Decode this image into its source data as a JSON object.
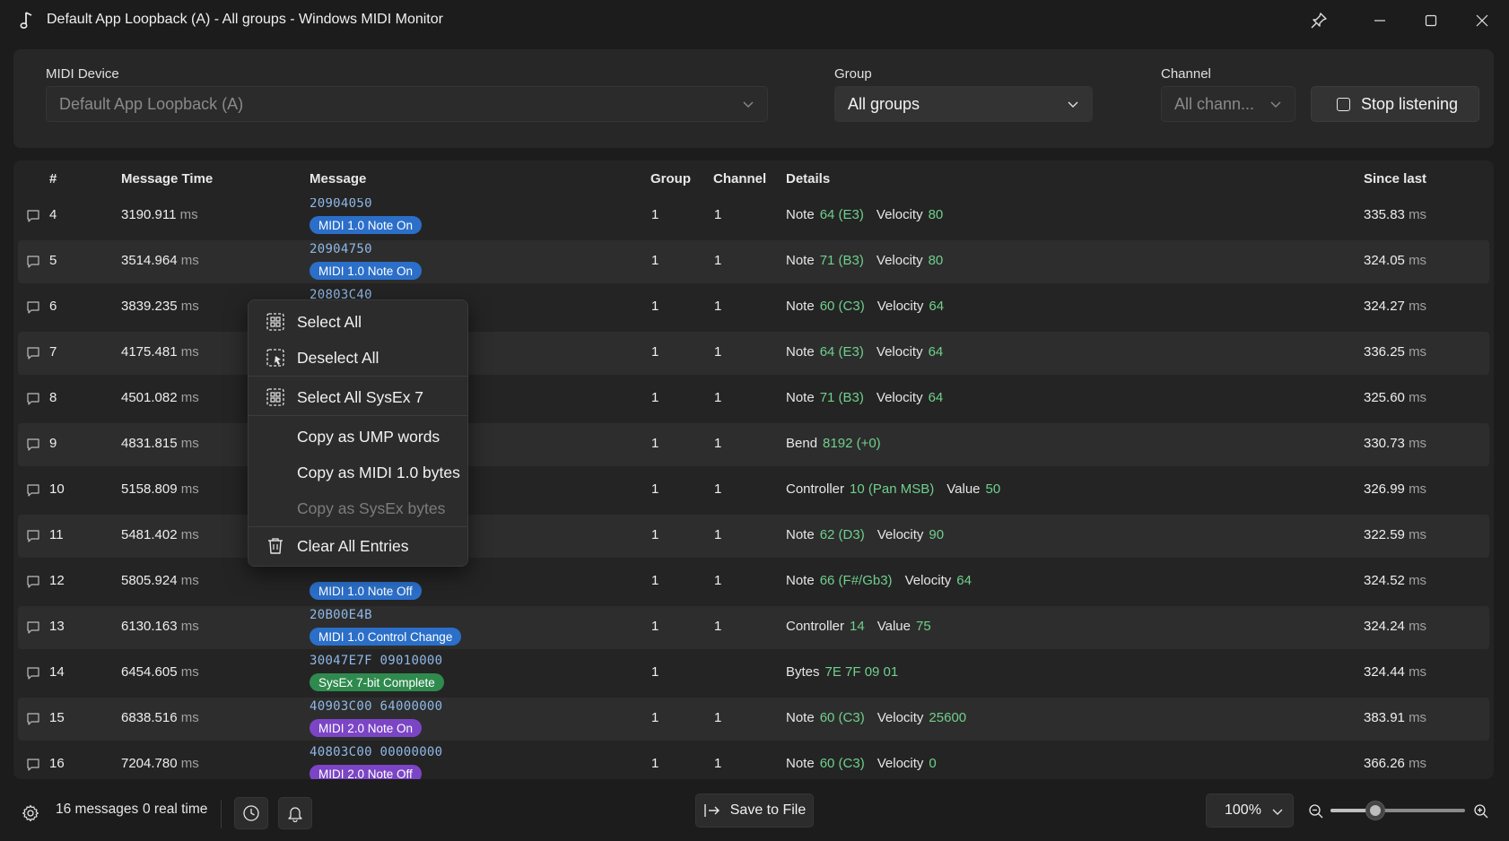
{
  "window": {
    "title": "Default App Loopback (A) - All groups - Windows MIDI Monitor"
  },
  "filters": {
    "midi_device_label": "MIDI Device",
    "midi_device_value": "Default App Loopback (A)",
    "group_label": "Group",
    "group_value": "All groups",
    "channel_label": "Channel",
    "channel_value": "All chann...",
    "stop_listening_label": "Stop listening"
  },
  "table": {
    "headers": {
      "num": "#",
      "time": "Message Time",
      "message": "Message",
      "group": "Group",
      "channel": "Channel",
      "details": "Details",
      "since_last": "Since last"
    },
    "unit": "ms",
    "rows": [
      {
        "num": "4",
        "time": "3190.911",
        "hex": "20904050",
        "badge": "MIDI 1.0 Note On",
        "kind": "m1",
        "group": "1",
        "channel": "1",
        "details": [
          [
            "Note",
            "64 (E3)"
          ],
          [
            "Velocity",
            "80"
          ]
        ],
        "since": "335.83"
      },
      {
        "num": "5",
        "time": "3514.964",
        "hex": "20904750",
        "badge": "MIDI 1.0 Note On",
        "kind": "m1",
        "group": "1",
        "channel": "1",
        "details": [
          [
            "Note",
            "71 (B3)"
          ],
          [
            "Velocity",
            "80"
          ]
        ],
        "since": "324.05"
      },
      {
        "num": "6",
        "time": "3839.235",
        "hex": "20803C40",
        "badge": "",
        "kind": "m1",
        "group": "1",
        "channel": "1",
        "details": [
          [
            "Note",
            "60 (C3)"
          ],
          [
            "Velocity",
            "64"
          ]
        ],
        "since": "324.27"
      },
      {
        "num": "7",
        "time": "4175.481",
        "hex": "",
        "badge": "",
        "kind": "m1",
        "group": "1",
        "channel": "1",
        "details": [
          [
            "Note",
            "64 (E3)"
          ],
          [
            "Velocity",
            "64"
          ]
        ],
        "since": "336.25"
      },
      {
        "num": "8",
        "time": "4501.082",
        "hex": "",
        "badge": "",
        "kind": "m1",
        "group": "1",
        "channel": "1",
        "details": [
          [
            "Note",
            "71 (B3)"
          ],
          [
            "Velocity",
            "64"
          ]
        ],
        "since": "325.60"
      },
      {
        "num": "9",
        "time": "4831.815",
        "hex": "",
        "badge": "",
        "kind": "m1",
        "group": "1",
        "channel": "1",
        "details": [
          [
            "Bend",
            "8192 (+0)"
          ]
        ],
        "since": "330.73"
      },
      {
        "num": "10",
        "time": "5158.809",
        "hex": "",
        "badge": "",
        "kind": "m1",
        "group": "1",
        "channel": "1",
        "details": [
          [
            "Controller",
            "10 (Pan MSB)"
          ],
          [
            "Value",
            "50"
          ]
        ],
        "since": "326.99"
      },
      {
        "num": "11",
        "time": "5481.402",
        "hex": "",
        "badge": "",
        "kind": "m1",
        "group": "1",
        "channel": "1",
        "details": [
          [
            "Note",
            "62 (D3)"
          ],
          [
            "Velocity",
            "90"
          ]
        ],
        "since": "322.59"
      },
      {
        "num": "12",
        "time": "5805.924",
        "hex": "",
        "badge": "MIDI 1.0 Note Off",
        "kind": "m1",
        "group": "1",
        "channel": "1",
        "details": [
          [
            "Note",
            "66 (F#/Gb3)"
          ],
          [
            "Velocity",
            "64"
          ]
        ],
        "since": "324.52"
      },
      {
        "num": "13",
        "time": "6130.163",
        "hex": "20B00E4B",
        "badge": "MIDI 1.0 Control Change",
        "kind": "m1",
        "group": "1",
        "channel": "1",
        "details": [
          [
            "Controller",
            "14"
          ],
          [
            "Value",
            "75"
          ]
        ],
        "since": "324.24"
      },
      {
        "num": "14",
        "time": "6454.605",
        "hex": "30047E7F  09010000",
        "badge": "SysEx 7-bit Complete",
        "kind": "sys",
        "group": "1",
        "channel": "",
        "details": [
          [
            "Bytes",
            "7E 7F 09 01"
          ]
        ],
        "since": "324.44"
      },
      {
        "num": "15",
        "time": "6838.516",
        "hex": "40903C00  64000000",
        "badge": "MIDI 2.0 Note On",
        "kind": "m2",
        "group": "1",
        "channel": "1",
        "details": [
          [
            "Note",
            "60 (C3)"
          ],
          [
            "Velocity",
            "25600"
          ]
        ],
        "since": "383.91"
      },
      {
        "num": "16",
        "time": "7204.780",
        "hex": "40803C00  00000000",
        "badge": "MIDI 2.0 Note Off",
        "kind": "m2",
        "group": "1",
        "channel": "1",
        "details": [
          [
            "Note",
            "60 (C3)"
          ],
          [
            "Velocity",
            "0"
          ]
        ],
        "since": "366.26"
      }
    ]
  },
  "context_menu": {
    "select_all": "Select All",
    "deselect_all": "Deselect All",
    "select_all_sysex7": "Select All SysEx 7",
    "copy_ump": "Copy as UMP words",
    "copy_midi1": "Copy as MIDI 1.0 bytes",
    "copy_sysex": "Copy as SysEx bytes",
    "clear_all": "Clear All Entries"
  },
  "footer": {
    "message_count": "16 messages",
    "real_time": "0 real time",
    "save_to_file": "Save to File",
    "zoom_value": "100%",
    "zoom_fraction": 0.33
  },
  "colors": {
    "accent_m1": "#2b6fc9",
    "accent_sysex": "#2f8a4e",
    "accent_m2": "#7b45c6",
    "detail_value": "#6fd08c",
    "hex_text": "#8fb8e8"
  }
}
